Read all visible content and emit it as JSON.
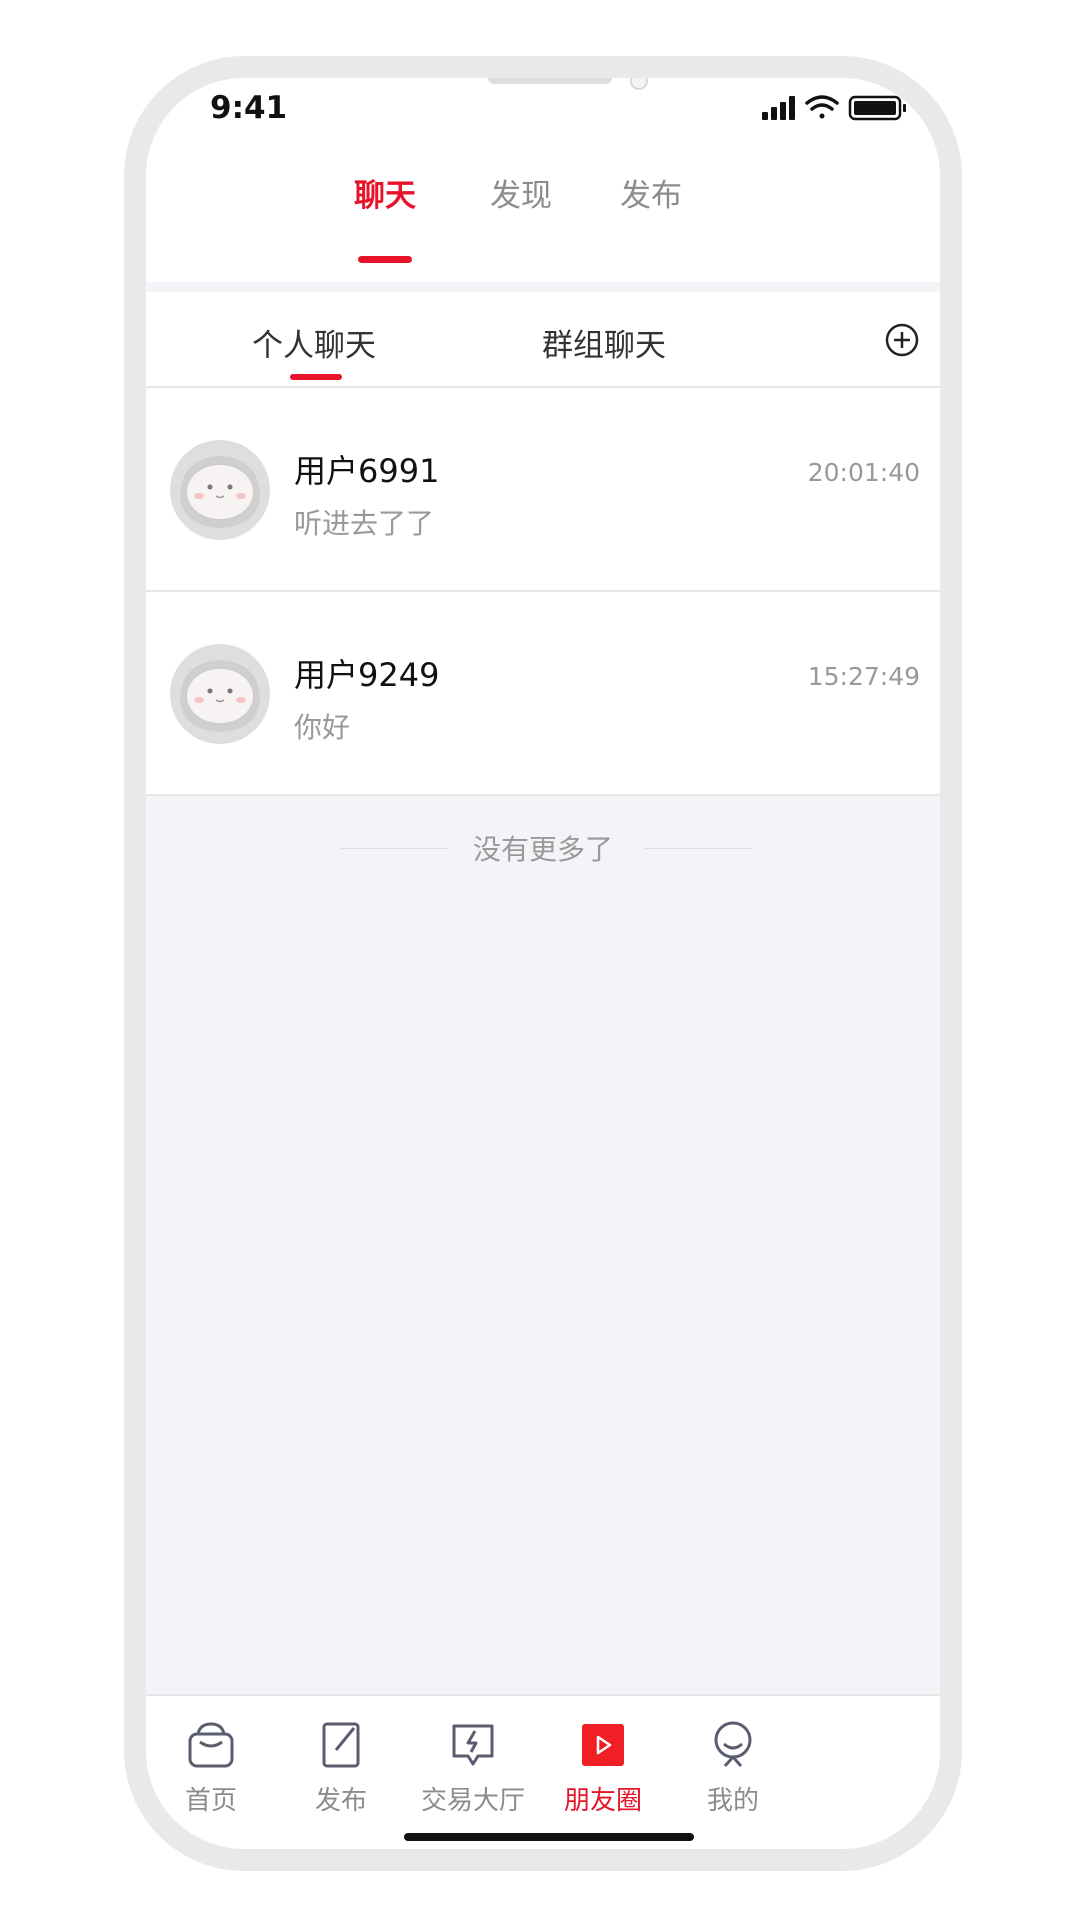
{
  "status_bar": {
    "time": "9:41"
  },
  "top_tabs": [
    {
      "label": "聊天",
      "active": true
    },
    {
      "label": "发现",
      "active": false
    },
    {
      "label": "发布",
      "active": false
    }
  ],
  "sub_tabs": [
    {
      "label": "个人聊天",
      "active": true
    },
    {
      "label": "群组聊天",
      "active": false
    }
  ],
  "add_icon": "plus-circle-icon",
  "chats": [
    {
      "name": "用户6991",
      "preview": "听进去了了",
      "time": "20:01:40"
    },
    {
      "name": "用户9249",
      "preview": "你好",
      "time": "15:27:49"
    }
  ],
  "no_more": "没有更多了",
  "bottom_nav": [
    {
      "label": "首页",
      "icon": "home-icon"
    },
    {
      "label": "发布",
      "icon": "publish-icon"
    },
    {
      "label": "交易大厅",
      "icon": "trade-hall-icon"
    },
    {
      "label": "朋友圈",
      "icon": "moments-icon",
      "active": true
    },
    {
      "label": "我的",
      "icon": "profile-icon"
    }
  ],
  "colors": {
    "accent": "#e8132a",
    "background": "#f3f4f7"
  }
}
